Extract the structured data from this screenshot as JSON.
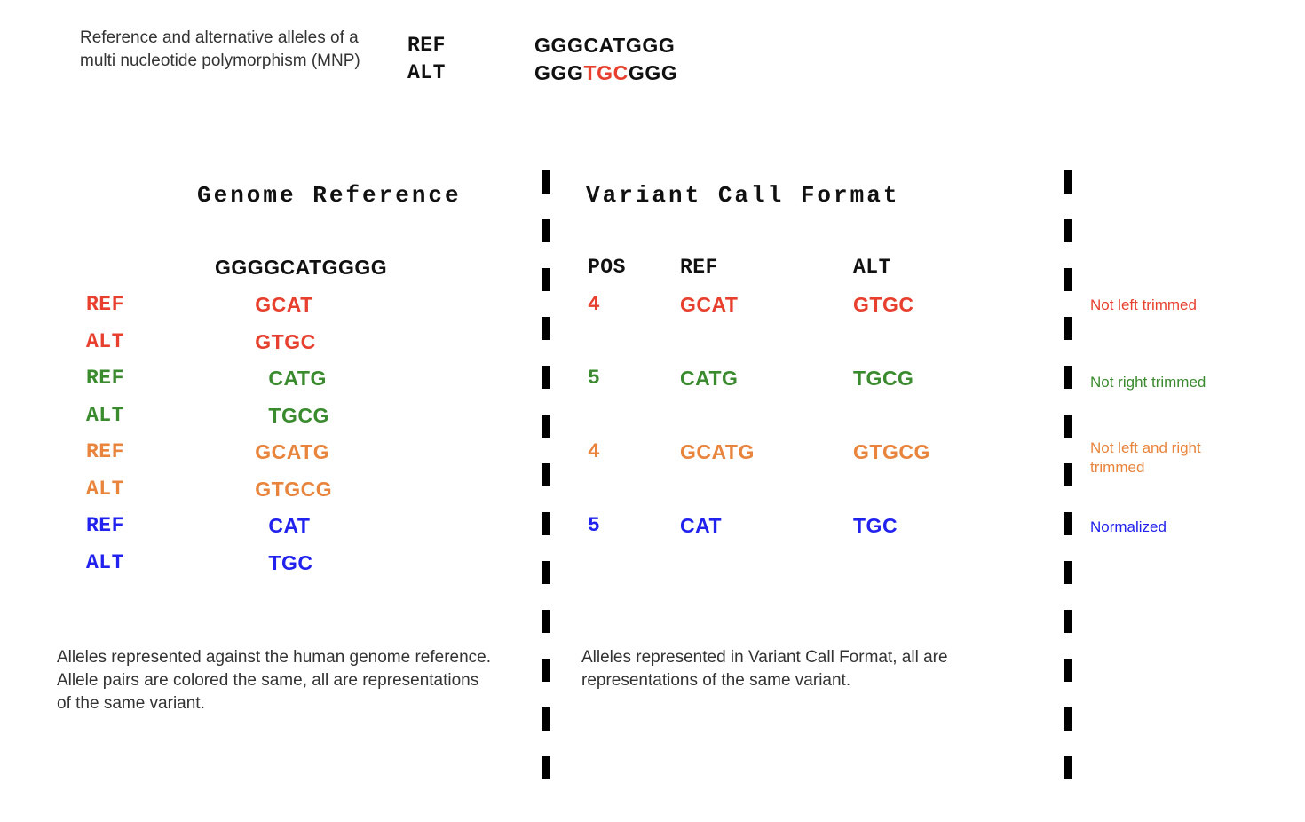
{
  "colors": {
    "black": "#111111",
    "red": "#e8402e",
    "green": "#3a8a2e",
    "orange": "#e8843c",
    "blue": "#2222ee",
    "text_gray": "#333333"
  },
  "top": {
    "description": "Reference and alternative alleles of a multi nucleotide polymorphism (MNP)",
    "ref_label": "REF",
    "alt_label": "ALT",
    "ref_sequence": "GGGCATGGG",
    "alt_sequence_prefix": "GGG",
    "alt_sequence_variant": "TGC",
    "alt_sequence_suffix": "GGG"
  },
  "genome_panel": {
    "heading": "Genome Reference",
    "reference_sequence": "GGGGCATGGGG",
    "rows": [
      {
        "label": "REF",
        "sequence": "GCAT",
        "offset": 3,
        "color": "#e8402e"
      },
      {
        "label": "ALT",
        "sequence": "GTGC",
        "offset": 3,
        "color": "#e8402e"
      },
      {
        "label": "REF",
        "sequence": "CATG",
        "offset": 4,
        "color": "#3a8a2e"
      },
      {
        "label": "ALT",
        "sequence": "TGCG",
        "offset": 4,
        "color": "#3a8a2e"
      },
      {
        "label": "REF",
        "sequence": "GCATG",
        "offset": 3,
        "color": "#e8843c"
      },
      {
        "label": "ALT",
        "sequence": "GTGCG",
        "offset": 3,
        "color": "#e8843c"
      },
      {
        "label": "REF",
        "sequence": "CAT",
        "offset": 4,
        "color": "#2222ee"
      },
      {
        "label": "ALT",
        "sequence": "TGC",
        "offset": 4,
        "color": "#2222ee"
      }
    ],
    "caption": "Alleles represented against the human genome reference.  Allele pairs are colored the same, all are representations of the same variant."
  },
  "vcf_panel": {
    "heading": "Variant Call Format",
    "headers": {
      "pos": "POS",
      "ref": "REF",
      "alt": "ALT"
    },
    "rows": [
      {
        "pos": "4",
        "ref": "GCAT",
        "alt": "GTGC",
        "color": "#e8402e"
      },
      {
        "pos": "5",
        "ref": "CATG",
        "alt": "TGCG",
        "color": "#3a8a2e"
      },
      {
        "pos": "4",
        "ref": "GCATG",
        "alt": "GTGCG",
        "color": "#e8843c"
      },
      {
        "pos": "5",
        "ref": "CAT",
        "alt": "TGC",
        "color": "#2222ee"
      }
    ],
    "caption": "Alleles represented in Variant Call Format, all are representations of the same variant."
  },
  "annotations": [
    {
      "text": "Not left trimmed",
      "color": "#e8402e"
    },
    {
      "text": "Not right trimmed",
      "color": "#3a8a2e"
    },
    {
      "text": "Not left and right trimmed",
      "color": "#e8843c"
    },
    {
      "text": "Normalized",
      "color": "#2222ee"
    }
  ]
}
